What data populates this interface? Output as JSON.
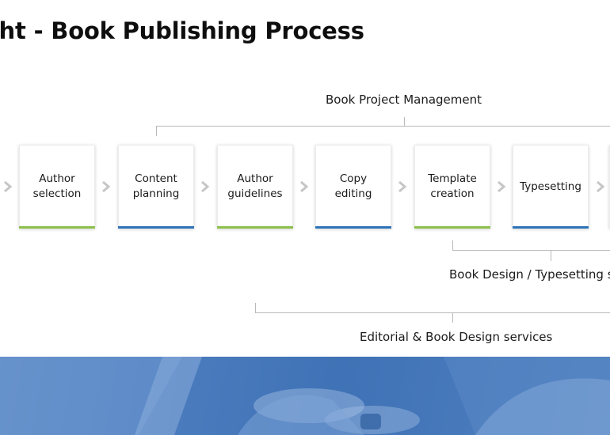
{
  "title": "ght - Book Publishing Process",
  "brackets": {
    "top_label": "Book Project Management",
    "middle_label": "Book Design / Typesetting s",
    "bottom_label": "Editorial & Book Design services"
  },
  "steps": [
    {
      "label": "Author\nselection",
      "accent": "#8cc04b"
    },
    {
      "label": "Content\nplanning",
      "accent": "#2f74b8"
    },
    {
      "label": "Author\nguidelines",
      "accent": "#8cc04b"
    },
    {
      "label": "Copy\nediting",
      "accent": "#2f74b8"
    },
    {
      "label": "Template\ncreation",
      "accent": "#8cc04b"
    },
    {
      "label": "Typesetting",
      "accent": "#2f74b8"
    }
  ],
  "colors": {
    "green": "#8cc04b",
    "blue": "#2f74b8",
    "chevron": "#c6c6c6",
    "photo_tint": "#4a7bbd"
  }
}
